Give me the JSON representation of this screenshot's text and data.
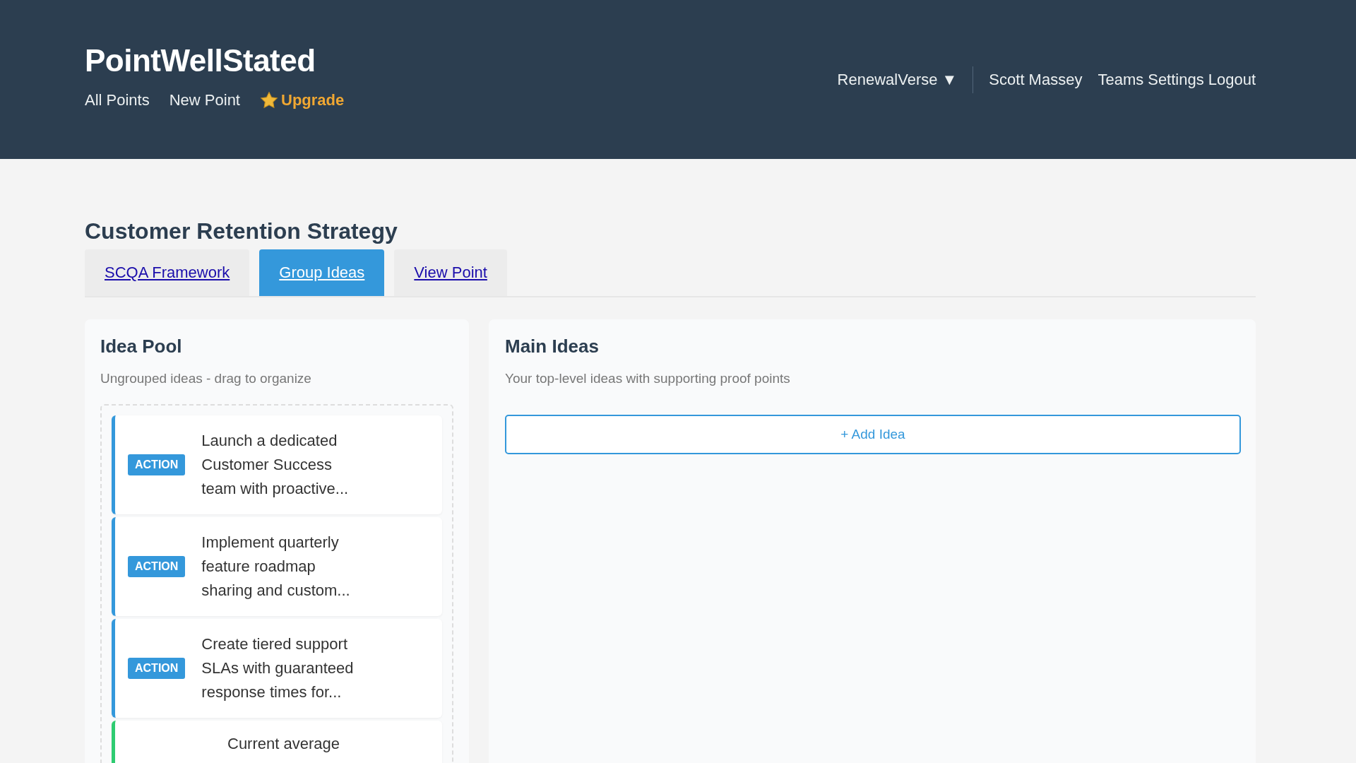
{
  "header": {
    "logo": "PointWellStated",
    "nav": [
      {
        "label": "All Points",
        "kind": "link"
      },
      {
        "label": "New Point",
        "kind": "link"
      },
      {
        "label": "Upgrade",
        "kind": "upgrade"
      }
    ],
    "workspace": "RenewalVerse ▼",
    "user": "Scott Massey",
    "links": [
      "Teams",
      "Settings",
      "Logout"
    ]
  },
  "page": {
    "title": "Customer Retention Strategy",
    "tabs": [
      {
        "label": "SCQA Framework",
        "selected": false
      },
      {
        "label": "Group Ideas",
        "selected": true
      },
      {
        "label": "View Point",
        "selected": false
      }
    ]
  },
  "idea_pool": {
    "title": "Idea Pool",
    "subtitle": "Ungrouped ideas - drag to organize",
    "cards": [
      {
        "kind": "action",
        "badge": "ACTION",
        "text": "Launch a dedicated Customer Success team with proactive..."
      },
      {
        "kind": "action",
        "badge": "ACTION",
        "text": "Implement quarterly feature roadmap sharing and custom..."
      },
      {
        "kind": "action",
        "badge": "ACTION",
        "text": "Create tiered support SLAs with guaranteed response times for..."
      },
      {
        "kind": "evidence",
        "text": "Current average"
      }
    ]
  },
  "main_ideas": {
    "title": "Main Ideas",
    "subtitle": "Your top-level ideas with supporting proof points",
    "add_button": "+ Add Idea"
  }
}
